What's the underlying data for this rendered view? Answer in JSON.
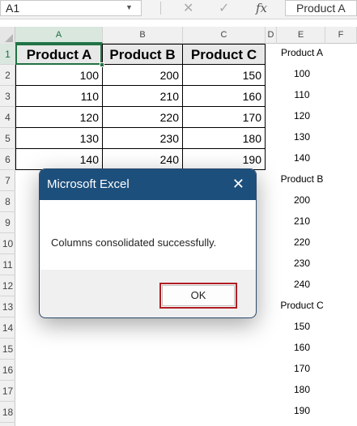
{
  "formula_bar": {
    "name_box": "A1",
    "formula": "Product A",
    "icons": [
      "cancel-icon",
      "enter-icon",
      "function-icon"
    ]
  },
  "columns": [
    "A",
    "B",
    "C",
    "D",
    "E",
    "F"
  ],
  "rows": [
    "1",
    "2",
    "3",
    "4",
    "5",
    "6",
    "7",
    "8",
    "9",
    "10",
    "11",
    "12",
    "13",
    "14",
    "15",
    "16",
    "17",
    "18"
  ],
  "selected": {
    "column": "A",
    "row": "1"
  },
  "table": {
    "headers": [
      "Product A",
      "Product B",
      "Product C"
    ],
    "rows": [
      [
        "100",
        "200",
        "150"
      ],
      [
        "110",
        "210",
        "160"
      ],
      [
        "120",
        "220",
        "170"
      ],
      [
        "130",
        "230",
        "180"
      ],
      [
        "140",
        "240",
        "190"
      ]
    ]
  },
  "column_e": [
    "Product A",
    "100",
    "110",
    "120",
    "130",
    "140",
    "Product B",
    "200",
    "210",
    "220",
    "230",
    "240",
    "Product C",
    "150",
    "160",
    "170",
    "180",
    "190"
  ],
  "dialog": {
    "title": "Microsoft Excel",
    "message": "Columns consolidated successfully.",
    "ok_label": "OK"
  },
  "colors": {
    "dialog_titlebar": "#1d4f7c",
    "selection_accent": "#217346",
    "ok_highlight": "#b11d25"
  }
}
